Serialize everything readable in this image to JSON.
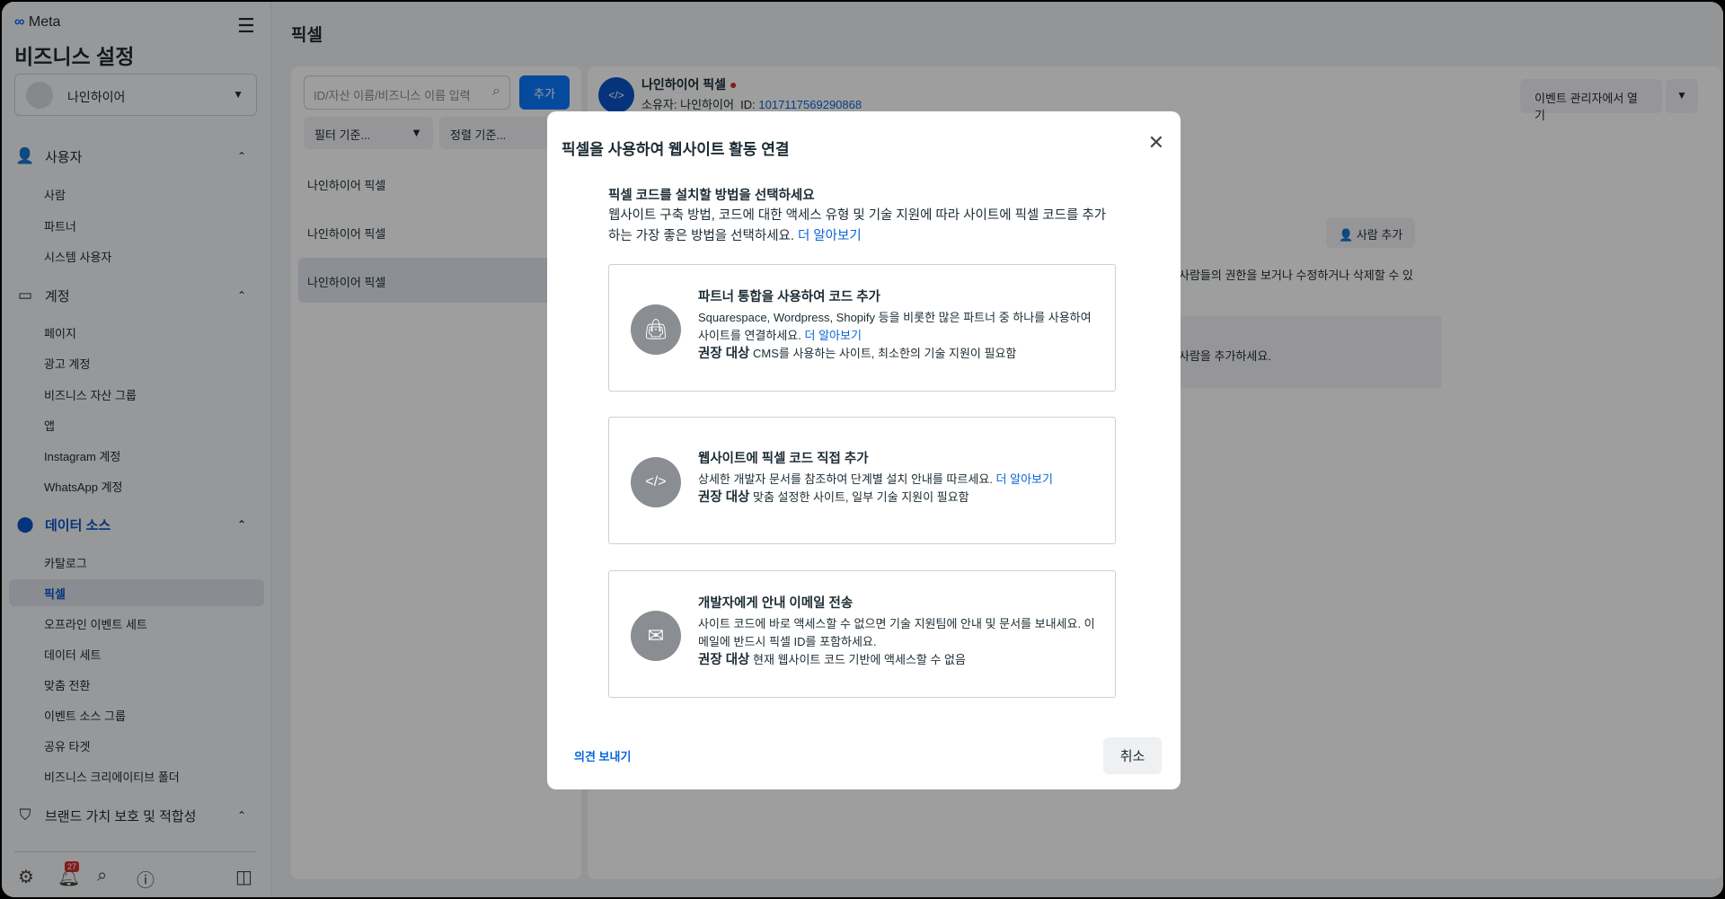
{
  "sidebar": {
    "logo": "Meta",
    "title": "비즈니스 설정",
    "account": "나인하이어",
    "sections": {
      "users": "사용자",
      "accounts": "계정",
      "data_sources": "데이터 소스",
      "brand": "브랜드 가치 보호 및 적합성"
    },
    "users_items": [
      "사람",
      "파트너",
      "시스템 사용자"
    ],
    "account_items": [
      "페이지",
      "광고 계정",
      "비즈니스 자산 그룹",
      "앱",
      "Instagram 계정",
      "WhatsApp 계정"
    ],
    "data_items": [
      "카탈로그",
      "픽셀",
      "오프라인 이벤트 세트",
      "데이터 세트",
      "맞춤 전환",
      "이벤트 소스 그룹",
      "공유 타겟",
      "비즈니스 크리에이티브 폴더"
    ],
    "notification_count": "27"
  },
  "main": {
    "title": "픽셀",
    "search_placeholder": "ID/자산 이름/비즈니스 이름 입력",
    "add": "추가",
    "filter": "필터 기준...",
    "sort": "정렬 기준...",
    "list": [
      "나인하이어 픽셀",
      "나인하이어 픽셀",
      "나인하이어 픽셀"
    ]
  },
  "detail": {
    "name": "나인하이어 픽셀",
    "owner": "소유자: 나인하이어",
    "id_label": "ID:",
    "id": "1017117569290868",
    "open_events": "이벤트 관리자에서 열기",
    "add_person": "사람 추가",
    "perm_text": "사람들의 권한을 보거나 수정하거나 삭제할 수 있",
    "add_text": "사람을 추가하세요."
  },
  "modal": {
    "title": "픽셀을 사용하여 웹사이트 활동 연결",
    "heading": "픽셀 코드를 설치할 방법을 선택하세요",
    "desc": "웹사이트 구축 방법, 코드에 대한 액세스 유형 및 기술 지원에 따라 사이트에 픽셀 코드를 추가하는 가장 좋은 방법을 선택하세요.",
    "learn_more": "더 알아보기",
    "options": [
      {
        "title": "파트너 통합을 사용하여 코드 추가",
        "desc": "Squarespace, Wordpress, Shopify 등을 비롯한 많은 파트너 중 하나를 사용하여 사이트를 연결하세요.",
        "link": "더 알아보기",
        "rec_label": "권장 대상",
        "rec": "CMS를 사용하는 사이트, 최소한의 기술 지원이 필요함"
      },
      {
        "title": "웹사이트에 픽셀 코드 직접 추가",
        "desc": "상세한 개발자 문서를 참조하여 단계별 설치 안내를 따르세요.",
        "link": "더 알아보기",
        "rec_label": "권장 대상",
        "rec": "맞춤 설정한 사이트, 일부 기술 지원이 필요함"
      },
      {
        "title": "개발자에게 안내 이메일 전송",
        "desc": "사이트 코드에 바로 액세스할 수 없으면 기술 지원팀에 안내 및 문서를 보내세요. 이메일에 반드시 픽셀 ID를 포함하세요.",
        "rec_label": "권장 대상",
        "rec": "현재 웹사이트 코드 기반에 액세스할 수 없음"
      }
    ],
    "feedback": "의견 보내기",
    "cancel": "취소"
  }
}
